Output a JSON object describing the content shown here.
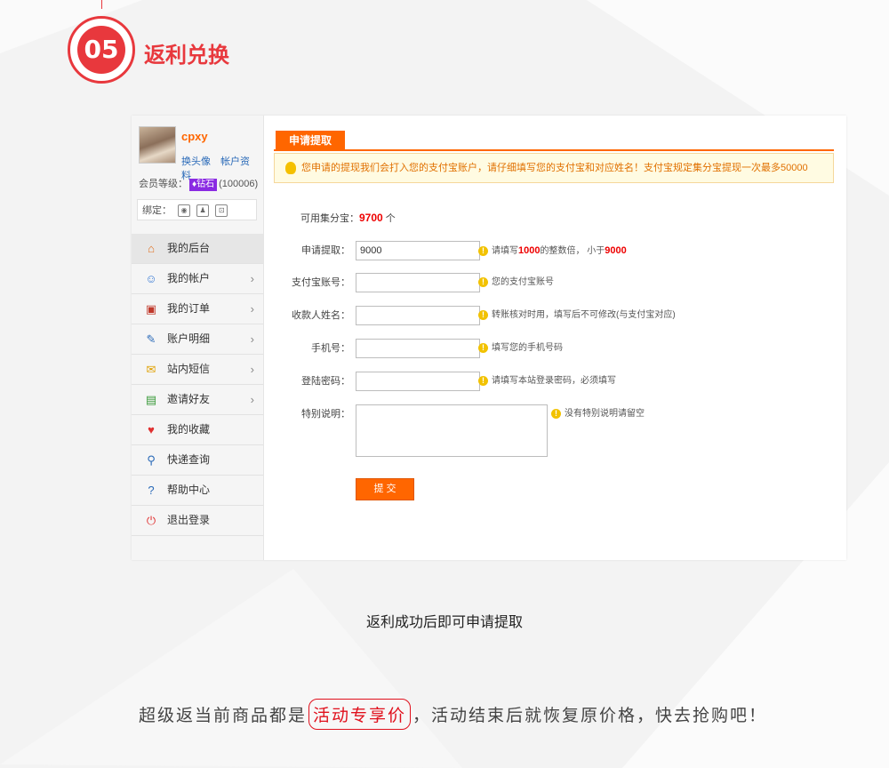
{
  "step": {
    "number": "05",
    "title": "返利兑换"
  },
  "user": {
    "name": "cpxy",
    "links": [
      "换头像",
      "帐户资料"
    ],
    "level_label": "会员等级：",
    "level_badge": "钻石",
    "level_points": "(100006)",
    "bind_label": "绑定："
  },
  "menu": [
    {
      "label": "我的后台",
      "icon": "home-icon",
      "arrow": false
    },
    {
      "label": "我的帐户",
      "icon": "user-icon",
      "arrow": true
    },
    {
      "label": "我的订单",
      "icon": "cart-icon",
      "arrow": true
    },
    {
      "label": "账户明细",
      "icon": "edit-icon",
      "arrow": true
    },
    {
      "label": "站内短信",
      "icon": "mail-icon",
      "arrow": true
    },
    {
      "label": "邀请好友",
      "icon": "invite-icon",
      "arrow": true
    },
    {
      "label": "我的收藏",
      "icon": "heart-icon",
      "arrow": false
    },
    {
      "label": "快递查询",
      "icon": "search-icon",
      "arrow": false
    },
    {
      "label": "帮助中心",
      "icon": "help-icon",
      "arrow": false
    },
    {
      "label": "退出登录",
      "icon": "power-icon",
      "arrow": false
    }
  ],
  "tab": "申请提取",
  "notice": "您申请的提现我们会打入您的支付宝账户，请仔细填写您的支付宝和对应姓名！支付宝规定集分宝提现一次最多50000",
  "available": {
    "label": "可用集分宝：",
    "value": "9700",
    "unit": "个"
  },
  "form": {
    "amount": {
      "label": "申请提取：",
      "value": "9000",
      "tip_pre": "请填写",
      "tip_num1": "1000",
      "tip_mid": "的整数倍，  小于",
      "tip_num2": "9000"
    },
    "alipay": {
      "label": "支付宝账号：",
      "tip": "您的支付宝账号"
    },
    "name": {
      "label": "收款人姓名：",
      "tip": "转账核对时用，填写后不可修改(与支付宝对应)"
    },
    "phone": {
      "label": "手机号：",
      "tip": "填写您的手机号码"
    },
    "password": {
      "label": "登陆密码：",
      "tip": "请填写本站登录密码，必须填写"
    },
    "note": {
      "label": "特别说明：",
      "tip": "没有特别说明请留空"
    },
    "submit": "提 交"
  },
  "caption": "返利成功后即可申请提取",
  "slogan": {
    "pre": "超级返当前商品都是",
    "highlight": "活动专享价",
    "post": "，活动结束后就恢复原价格，快去抢购吧！"
  },
  "colors": {
    "accent": "#ff6600",
    "brand_red": "#e8383d",
    "notice_bg": "#fffbe2"
  }
}
